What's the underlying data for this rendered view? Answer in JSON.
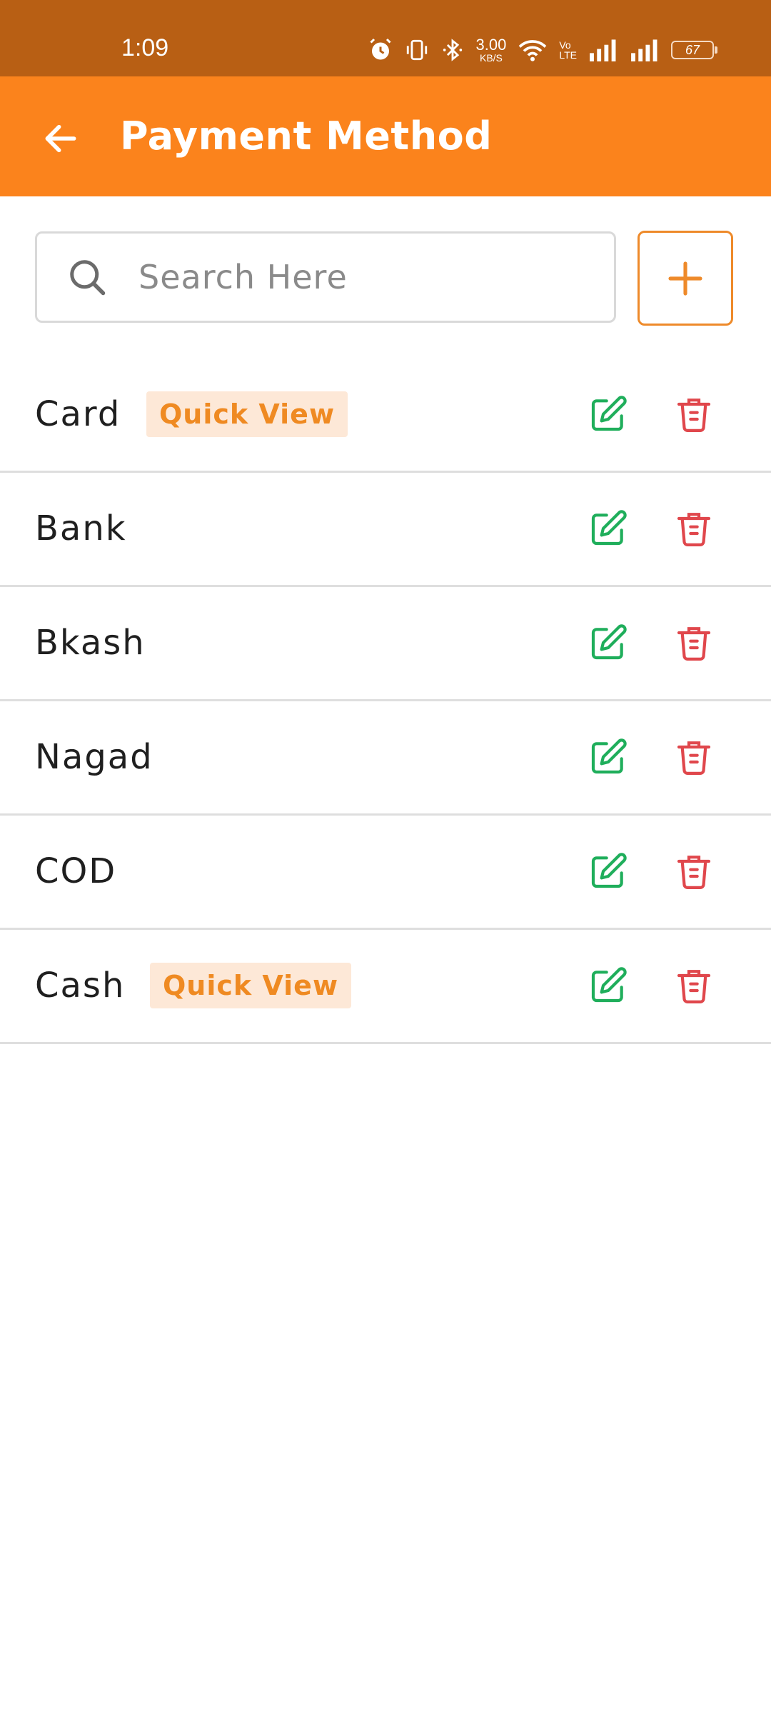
{
  "status_bar": {
    "time": "1:09",
    "net_speed_value": "3.00",
    "net_speed_unit": "KB/S",
    "volte_top": "Vo",
    "volte_bottom": "LTE",
    "battery": "67"
  },
  "app_bar": {
    "title": "Payment Method",
    "background": "#fb831c"
  },
  "search": {
    "placeholder": "Search Here",
    "value": ""
  },
  "add_button": {
    "icon": "plus-icon"
  },
  "colors": {
    "accent": "#fb831c",
    "edit": "#1fae5b",
    "delete": "#e0474c",
    "badge_bg": "#fde8d7",
    "badge_text": "#ef8a22"
  },
  "payment_methods": [
    {
      "name": "Card",
      "quick_view": "Quick View"
    },
    {
      "name": "Bank"
    },
    {
      "name": "Bkash"
    },
    {
      "name": "Nagad"
    },
    {
      "name": "COD"
    },
    {
      "name": "Cash",
      "quick_view": "Quick View"
    }
  ]
}
